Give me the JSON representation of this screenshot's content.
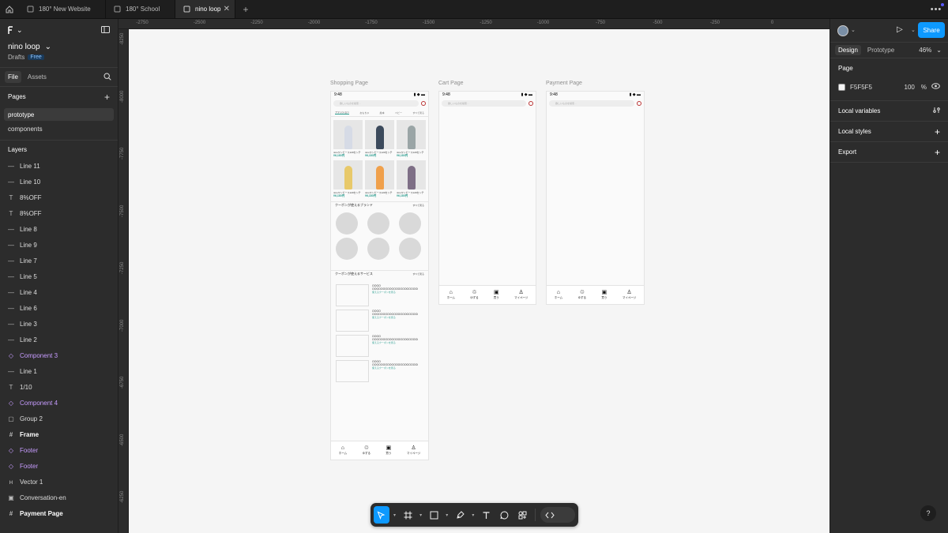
{
  "tabs": [
    {
      "label": "180° New Website"
    },
    {
      "label": "180° School"
    },
    {
      "label": "nino loop"
    }
  ],
  "file": {
    "name": "nino loop",
    "location": "Drafts",
    "plan_badge": "Free"
  },
  "left_tabs": {
    "file": "File",
    "assets": "Assets"
  },
  "pages": {
    "heading": "Pages",
    "items": [
      "prototype",
      "components"
    ]
  },
  "layers": {
    "heading": "Layers",
    "items": [
      {
        "name": "Line 11",
        "icon": "line-icon"
      },
      {
        "name": "Line 10",
        "icon": "line-icon"
      },
      {
        "name": "8%OFF",
        "icon": "text-icon"
      },
      {
        "name": "8%OFF",
        "icon": "text-icon"
      },
      {
        "name": "Line 8",
        "icon": "line-icon"
      },
      {
        "name": "Line 9",
        "icon": "line-icon"
      },
      {
        "name": "Line 7",
        "icon": "line-icon"
      },
      {
        "name": "Line 5",
        "icon": "line-icon"
      },
      {
        "name": "Line 4",
        "icon": "line-icon"
      },
      {
        "name": "Line 6",
        "icon": "line-icon"
      },
      {
        "name": "Line 3",
        "icon": "line-icon"
      },
      {
        "name": "Line 2",
        "icon": "line-icon"
      },
      {
        "name": "Component 3",
        "icon": "component-instance-icon"
      },
      {
        "name": "Line 1",
        "icon": "line-icon"
      },
      {
        "name": "1/10",
        "icon": "text-icon"
      },
      {
        "name": "Component 4",
        "icon": "component-instance-icon"
      },
      {
        "name": "Group 2",
        "icon": "group-icon"
      },
      {
        "name": "Frame",
        "icon": "frame-icon"
      },
      {
        "name": "Footer",
        "icon": "component-instance-icon"
      },
      {
        "name": "Footer",
        "icon": "component-instance-icon"
      },
      {
        "name": "Vector 1",
        "icon": "vector-icon"
      },
      {
        "name": "Conversation-en",
        "icon": "image-icon"
      },
      {
        "name": "Payment Page",
        "icon": "frame-icon"
      }
    ]
  },
  "ruler_top": [
    "-2750",
    "-2500",
    "-2250",
    "-2000",
    "-1750",
    "-1500",
    "-1250",
    "-1000",
    "-750",
    "-500",
    "-250",
    "0"
  ],
  "ruler_left": [
    "-8250",
    "-8000",
    "-7750",
    "-7500",
    "-7250",
    "-7000",
    "-6750",
    "-6500",
    "-6250"
  ],
  "frames": {
    "shopping": "Shopping Page",
    "cart": "Cart Page",
    "payment": "Payment Page"
  },
  "phone": {
    "time": "9:48",
    "search_placeholder": "欲しいものを検索…",
    "categories": [
      "ファッション",
      "おもちゃ",
      "絵本",
      "ベビー",
      "すべて見る"
    ],
    "product_title": "ninoワンピース120センチ",
    "product_price": "¥6,180円",
    "brand_section": "クーポンが使えるブランド",
    "service_section": "クーポンが使えるサービス",
    "see_all": "すべて見る",
    "service_title": "OOOO",
    "service_desc": "OOOOOOOOOOOOOOOOOOOOOOOOOOO",
    "service_link": "使えるクーポンを見る",
    "nav": [
      "ホーム",
      "ゆずる",
      "買う",
      "マイページ"
    ],
    "kid_colors": [
      "#d6dbe6",
      "#3c4a5c",
      "#9aa5a6",
      "#e8c96a",
      "#f0a04b",
      "#7e6f86"
    ]
  },
  "right": {
    "share": "Share",
    "tab_design": "Design",
    "tab_prototype": "Prototype",
    "zoom": "46%",
    "page_heading": "Page",
    "page_color": "F5F5F5",
    "page_opacity": "100",
    "percent": "%",
    "local_variables": "Local variables",
    "local_styles": "Local styles",
    "export": "Export"
  },
  "help": "?",
  "colors": {
    "accent": "#0d99ff",
    "canvas": "#f5f5f5",
    "component": "#c79cff",
    "teal": "#2a9d8f"
  }
}
